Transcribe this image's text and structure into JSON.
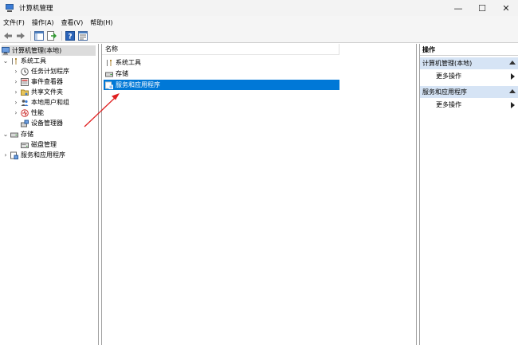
{
  "window": {
    "title": "计算机管理",
    "minimize_glyph": "—",
    "maximize_glyph": "☐",
    "close_glyph": "✕"
  },
  "menu": [
    "文件(F)",
    "操作(A)",
    "查看(V)",
    "帮助(H)"
  ],
  "toolbar": {
    "buttons": [
      "back-icon",
      "forward-icon",
      "show-hide-tree-icon",
      "export-list-icon",
      "help-icon",
      "properties-icon"
    ]
  },
  "tree": {
    "root": "计算机管理(本地)",
    "system_tools": "系统工具",
    "task_scheduler": "任务计划程序",
    "event_viewer": "事件查看器",
    "shared_folders": "共享文件夹",
    "local_users": "本地用户和组",
    "performance": "性能",
    "device_manager": "设备管理器",
    "storage": "存储",
    "disk_management": "磁盘管理",
    "services_apps": "服务和应用程序"
  },
  "list": {
    "column_name": "名称",
    "rows": [
      "系统工具",
      "存储",
      "服务和应用程序"
    ],
    "selected_index": 2
  },
  "actions": {
    "title": "操作",
    "group1": "计算机管理(本地)",
    "group1_more": "更多操作",
    "group2": "服务和应用程序",
    "group2_more": "更多操作"
  },
  "colors": {
    "selection": "#0078d7",
    "action_group_bg": "#d6e4f5",
    "annotation_arrow": "#e02020"
  }
}
